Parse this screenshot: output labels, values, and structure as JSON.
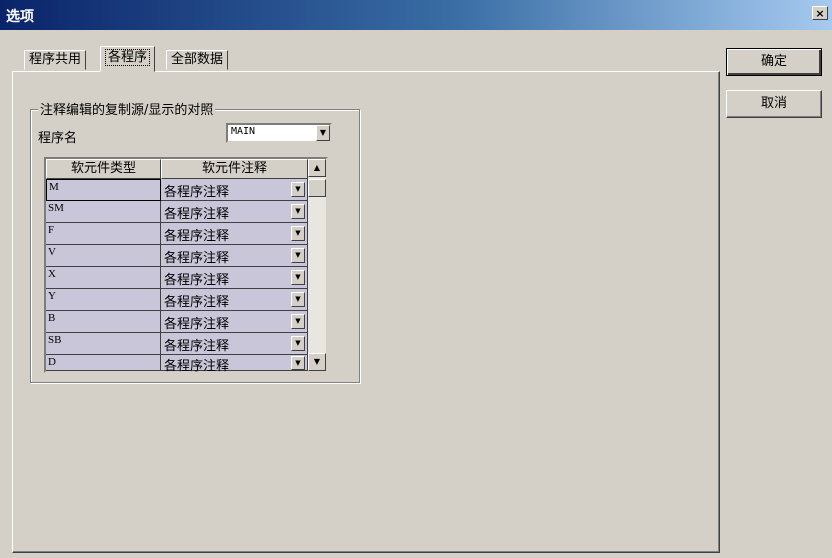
{
  "window": {
    "title": "选项",
    "close_label": "×"
  },
  "tabs": [
    {
      "label": "程序共用"
    },
    {
      "label": "各程序"
    },
    {
      "label": "全部数据"
    }
  ],
  "group": {
    "title": "注释编辑的复制源/显示的对照",
    "program_label": "程序名",
    "program_value": "MAIN"
  },
  "grid": {
    "headers": [
      "软元件类型",
      "软元件注释"
    ],
    "rows": [
      {
        "type": "M",
        "comment": "各程序注释"
      },
      {
        "type": "SM",
        "comment": "各程序注释"
      },
      {
        "type": "F",
        "comment": "各程序注释"
      },
      {
        "type": "V",
        "comment": "各程序注释"
      },
      {
        "type": "X",
        "comment": "各程序注释"
      },
      {
        "type": "Y",
        "comment": "各程序注释"
      },
      {
        "type": "B",
        "comment": "各程序注释"
      },
      {
        "type": "SB",
        "comment": "各程序注释"
      },
      {
        "type": "D",
        "comment": "各程序注释"
      }
    ]
  },
  "buttons": {
    "ok": "确定",
    "cancel": "取消"
  }
}
